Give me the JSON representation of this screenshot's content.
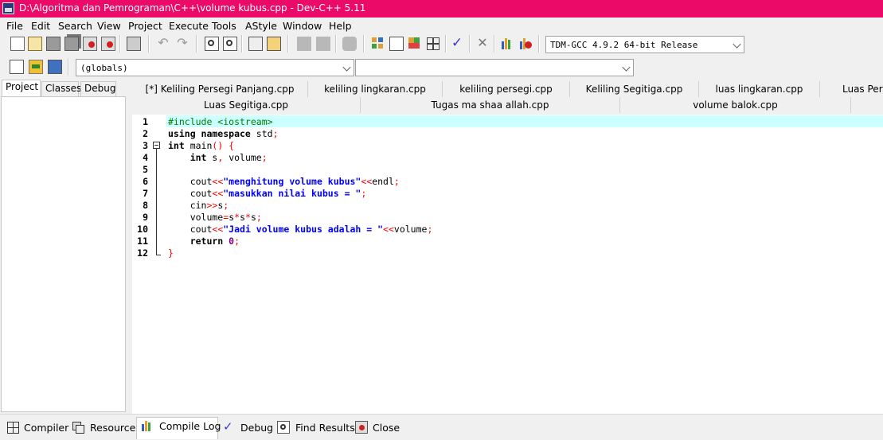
{
  "window": {
    "title": "D:\\Algoritma dan Pemrograman\\C++\\volume kubus.cpp - Dev-C++ 5.11"
  },
  "menu": [
    "File",
    "Edit",
    "Search",
    "View",
    "Project",
    "Execute",
    "Tools",
    "AStyle",
    "Window",
    "Help"
  ],
  "toolbar": {
    "compiler_select": "TDM-GCC 4.9.2 64-bit Release",
    "scope_select": "(globals)",
    "symbol_select": ""
  },
  "left_panel": {
    "tabs": [
      "Project",
      "Classes",
      "Debug"
    ],
    "active_tab": "Project"
  },
  "editor_tabs": {
    "row1": [
      "[*] Keliling Persegi Panjang.cpp",
      "keliling lingkaran.cpp",
      "keliling persegi.cpp",
      "Keliling Segitiga.cpp",
      "luas lingkaran.cpp",
      "Luas Perse"
    ],
    "row2": [
      "Luas Segitiga.cpp",
      "Tugas ma shaa allah.cpp",
      "volume balok.cpp"
    ]
  },
  "editor": {
    "line_numbers": [
      "1",
      "2",
      "3",
      "4",
      "5",
      "6",
      "7",
      "8",
      "9",
      "10",
      "11",
      "12"
    ],
    "lines": [
      [
        {
          "t": "#include <iostream>",
          "c": "pp"
        }
      ],
      [
        {
          "t": "using namespace ",
          "c": "kw"
        },
        {
          "t": "std",
          "c": "id"
        },
        {
          "t": ";",
          "c": "sym"
        }
      ],
      [
        {
          "t": "int ",
          "c": "kw"
        },
        {
          "t": "main",
          "c": "id"
        },
        {
          "t": "() {",
          "c": "sym"
        }
      ],
      [
        {
          "t": "    int ",
          "c": "kw"
        },
        {
          "t": "s",
          "c": "id"
        },
        {
          "t": ", ",
          "c": "sym"
        },
        {
          "t": "volume",
          "c": "id"
        },
        {
          "t": ";",
          "c": "sym"
        }
      ],
      [],
      [
        {
          "t": "    cout",
          "c": "id"
        },
        {
          "t": "<<",
          "c": "sym"
        },
        {
          "t": "\"menghitung volume kubus\"",
          "c": "str"
        },
        {
          "t": "<<",
          "c": "sym"
        },
        {
          "t": "endl",
          "c": "id"
        },
        {
          "t": ";",
          "c": "sym"
        }
      ],
      [
        {
          "t": "    cout",
          "c": "id"
        },
        {
          "t": "<<",
          "c": "sym"
        },
        {
          "t": "\"masukkan nilai kubus = \"",
          "c": "str"
        },
        {
          "t": ";",
          "c": "sym"
        }
      ],
      [
        {
          "t": "    cin",
          "c": "id"
        },
        {
          "t": ">>",
          "c": "sym"
        },
        {
          "t": "s",
          "c": "id"
        },
        {
          "t": ";",
          "c": "sym"
        }
      ],
      [
        {
          "t": "    volume",
          "c": "id"
        },
        {
          "t": "=",
          "c": "sym"
        },
        {
          "t": "s",
          "c": "id"
        },
        {
          "t": "*",
          "c": "sym"
        },
        {
          "t": "s",
          "c": "id"
        },
        {
          "t": "*",
          "c": "sym"
        },
        {
          "t": "s",
          "c": "id"
        },
        {
          "t": ";",
          "c": "sym"
        }
      ],
      [
        {
          "t": "    cout",
          "c": "id"
        },
        {
          "t": "<<",
          "c": "sym"
        },
        {
          "t": "\"Jadi volume kubus adalah = \"",
          "c": "str"
        },
        {
          "t": "<<",
          "c": "sym"
        },
        {
          "t": "volume",
          "c": "id"
        },
        {
          "t": ";",
          "c": "sym"
        }
      ],
      [
        {
          "t": "    return ",
          "c": "kw"
        },
        {
          "t": "0",
          "c": "num"
        },
        {
          "t": ";",
          "c": "sym"
        }
      ],
      [
        {
          "t": "}",
          "c": "sym"
        }
      ]
    ]
  },
  "bottom_tabs": [
    "Compiler",
    "Resources",
    "Compile Log",
    "Debug",
    "Find Results",
    "Close"
  ],
  "active_bottom_tab": "Compile Log",
  "colors": {
    "titlebar": "#ec0a68",
    "current_line": "#ccffff",
    "string": "#0000ff",
    "symbol": "#ff0000",
    "preprocessor": "#008000",
    "number": "#800080"
  }
}
